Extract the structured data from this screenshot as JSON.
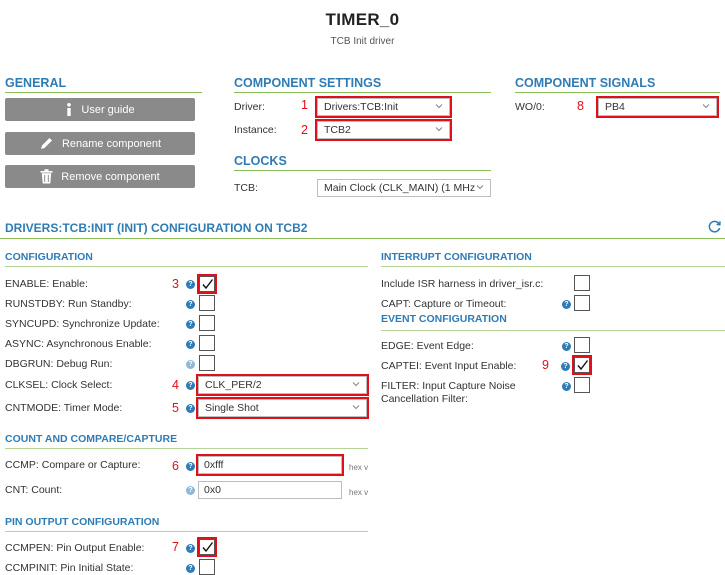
{
  "header": {
    "title": "TIMER_0",
    "subtitle": "TCB Init driver"
  },
  "general": {
    "heading": "GENERAL",
    "user_guide": "User guide",
    "rename": "Rename component",
    "remove": "Remove component"
  },
  "component_settings": {
    "heading": "COMPONENT SETTINGS",
    "driver_label": "Driver:",
    "driver_value": "Drivers:TCB:Init",
    "instance_label": "Instance:",
    "instance_value": "TCB2"
  },
  "clocks": {
    "heading": "CLOCKS",
    "tcb_label": "TCB:",
    "tcb_value": "Main Clock (CLK_MAIN) (1 MHz"
  },
  "component_signals": {
    "heading": "COMPONENT SIGNALS",
    "wo_label": "WO/0:",
    "wo_value": "PB4"
  },
  "config_title": "DRIVERS:TCB:INIT (INIT) CONFIGURATION ON TCB2",
  "configuration": {
    "heading": "CONFIGURATION",
    "enable": "ENABLE: Enable:",
    "runstdby": "RUNSTDBY: Run Standby:",
    "syncupd": "SYNCUPD: Synchronize Update:",
    "async": "ASYNC: Asynchronous Enable:",
    "dbgrun": "DBGRUN: Debug Run:",
    "clksel_label": "CLKSEL: Clock Select:",
    "clksel_value": "CLK_PER/2",
    "cntmode_label": "CNTMODE: Timer Mode:",
    "cntmode_value": "Single Shot"
  },
  "count_compare": {
    "heading": "COUNT AND COMPARE/CAPTURE",
    "ccmp_label": "CCMP: Compare or Capture:",
    "ccmp_value": "0xfff",
    "cnt_label": "CNT: Count:",
    "cnt_value": "0x0",
    "hex_suffix": "hex v"
  },
  "pin_output": {
    "heading": "PIN OUTPUT CONFIGURATION",
    "ccmpen": "CCMPEN: Pin Output Enable:",
    "ccmpinit": "CCMPINIT: Pin Initial State:"
  },
  "interrupt": {
    "heading": "INTERRUPT CONFIGURATION",
    "isr": "Include ISR harness in driver_isr.c:",
    "capt": "CAPT: Capture or Timeout:"
  },
  "event": {
    "heading": "EVENT CONFIGURATION",
    "edge": "EDGE: Event Edge:",
    "captei": "CAPTEI: Event Input Enable:",
    "filter_line1": "FILTER: Input Capture Noise",
    "filter_line2": "Cancellation Filter:"
  },
  "annotations": [
    "1",
    "2",
    "3",
    "4",
    "5",
    "6",
    "7",
    "8",
    "9"
  ],
  "help_glyph": "?",
  "colors": {
    "accent": "#2f7cb5",
    "rule": "#8bbf5a",
    "highlight": "#e0101a",
    "button": "#8a8a8a"
  }
}
